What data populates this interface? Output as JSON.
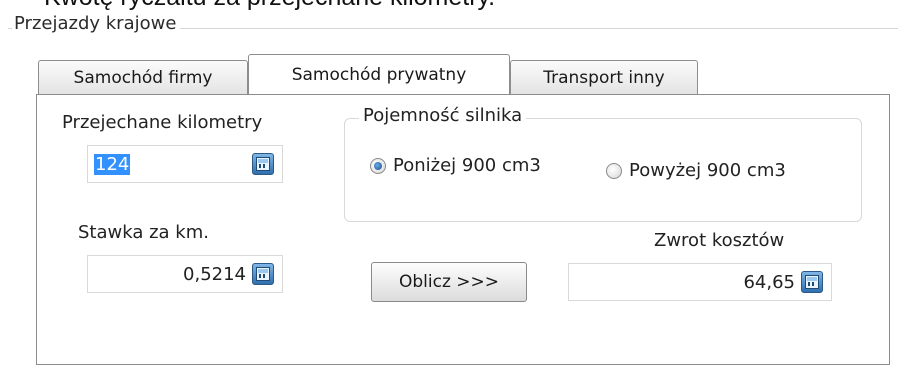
{
  "header": {
    "clipped_text": "Kwotę ryczałtu za przejechane kilometry."
  },
  "group": {
    "title": "Przejazdy krajowe"
  },
  "tabs": [
    {
      "label": "Samochód firmy",
      "active": false
    },
    {
      "label": "Samochód prywatny",
      "active": true
    },
    {
      "label": "Transport inny",
      "active": false
    }
  ],
  "form": {
    "km_label": "Przejechane kilometry",
    "km_value": "124",
    "rate_label": "Stawka za km.",
    "rate_value": "0,5214",
    "engine_group_label": "Pojemność silnika",
    "engine_options": [
      {
        "label": "Poniżej 900 cm3",
        "selected": true
      },
      {
        "label": "Powyżej 900 cm3",
        "selected": false
      }
    ],
    "calculate_button": "Oblicz >>>",
    "refund_label": "Zwrot kosztów",
    "refund_value": "64,65"
  },
  "icons": {
    "field_button": "calculator-icon"
  },
  "colors": {
    "selection": "#3390ff",
    "calculator_icon": "#2f6fae"
  }
}
